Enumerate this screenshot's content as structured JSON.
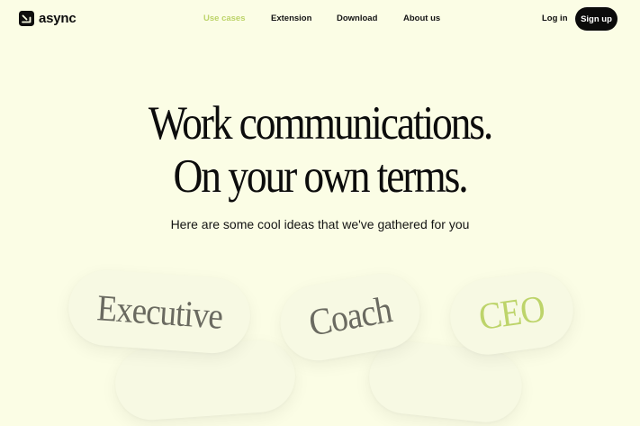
{
  "brand": {
    "name": "async"
  },
  "nav": {
    "links": [
      "Use cases",
      "Extension",
      "Download",
      "About us"
    ],
    "login": "Log in",
    "signup": "Sign up"
  },
  "hero": {
    "line1": "Work communications.",
    "line2": "On your own terms.",
    "subtitle": "Here are some cool ideas that we've gathered for you"
  },
  "roles": [
    "Executive",
    "Coach",
    "CEO"
  ],
  "colors": {
    "background": "#fbfde5",
    "accent": "#bdd46a",
    "primary_button": "#0b0b0b",
    "pill_text": "#6a6a60"
  }
}
